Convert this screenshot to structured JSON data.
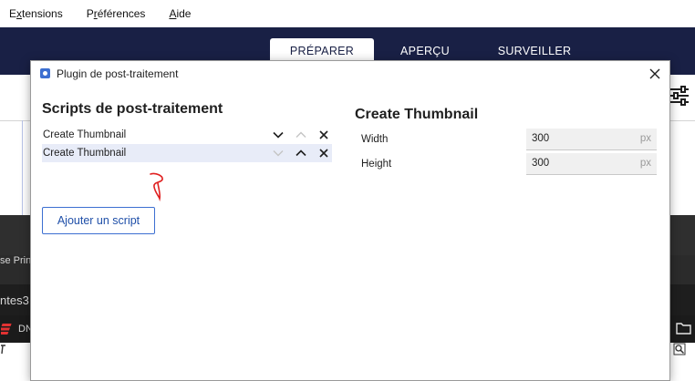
{
  "menubar": {
    "items": [
      {
        "pre": "E",
        "under": "x",
        "post": "tensions"
      },
      {
        "pre": "P",
        "under": "r",
        "post": "éférences"
      },
      {
        "pre": "",
        "under": "A",
        "post": "ide"
      }
    ]
  },
  "header": {
    "tabs": [
      "PRÉPARER",
      "APERÇU",
      "SURVEILLER"
    ],
    "active_tab": "PRÉPARER"
  },
  "background": {
    "dark_text_1": "se Prin",
    "dark_text_2": "ntes3",
    "dark_text_3": "DN"
  },
  "dialog": {
    "title": "Plugin de post-traitement",
    "scripts_title": "Scripts de post-traitement",
    "scripts": [
      "Create Thumbnail",
      "Create Thumbnail"
    ],
    "add_button": "Ajouter un script",
    "settings_title": "Create Thumbnail",
    "settings": [
      {
        "label": "Width",
        "value": "300",
        "unit": "px"
      },
      {
        "label": "Height",
        "value": "300",
        "unit": "px"
      }
    ]
  },
  "colors": {
    "header_bg": "#192045",
    "accent": "#3c6fd1",
    "annotation": "#e02020"
  }
}
